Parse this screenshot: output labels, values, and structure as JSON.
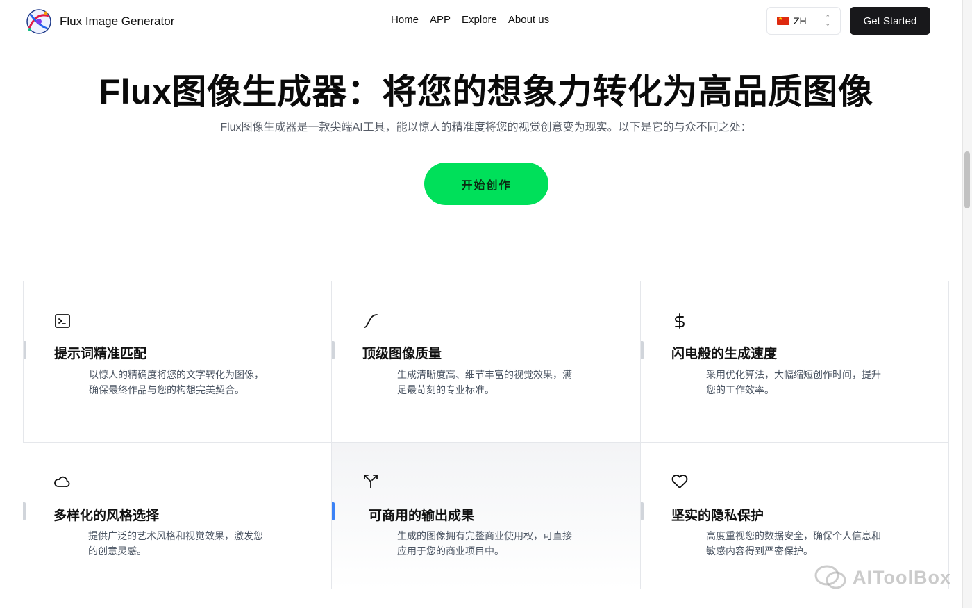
{
  "header": {
    "brand_name": "Flux Image Generator",
    "nav": [
      "Home",
      "APP",
      "Explore",
      "About us"
    ],
    "language": "ZH",
    "cta_label": "Get Started"
  },
  "hero": {
    "title": "Flux图像生成器：将您的想象力转化为高品质图像",
    "subtitle": "Flux图像生成器是一款尖端AI工具，能以惊人的精准度将您的视觉创意变为现实。以下是它的与众不同之处：",
    "button_label": "开始创作"
  },
  "features": [
    {
      "icon": "terminal-icon",
      "title": "提示词精准匹配",
      "desc": "以惊人的精确度将您的文字转化为图像，确保最终作品与您的构想完美契合。"
    },
    {
      "icon": "curve-icon",
      "title": "顶级图像质量",
      "desc": "生成清晰度高、细节丰富的视觉效果，满足最苛刻的专业标准。"
    },
    {
      "icon": "dollar-icon",
      "title": "闪电般的生成速度",
      "desc": "采用优化算法，大幅缩短创作时间，提升您的工作效率。"
    },
    {
      "icon": "cloud-icon",
      "title": "多样化的风格选择",
      "desc": "提供广泛的艺术风格和视觉效果，激发您的创意灵感。"
    },
    {
      "icon": "split-arrows-icon",
      "title": "可商用的输出成果",
      "desc": "生成的图像拥有完整商业使用权，可直接应用于您的商业项目中。"
    },
    {
      "icon": "heart-icon",
      "title": "坚实的隐私保护",
      "desc": "高度重视您的数据安全，确保个人信息和敏感内容得到严密保护。"
    }
  ],
  "watermark": "AIToolBox",
  "colors": {
    "accent_green": "#00e05a",
    "dark": "#18181b",
    "active_marker": "#3b82f6"
  }
}
